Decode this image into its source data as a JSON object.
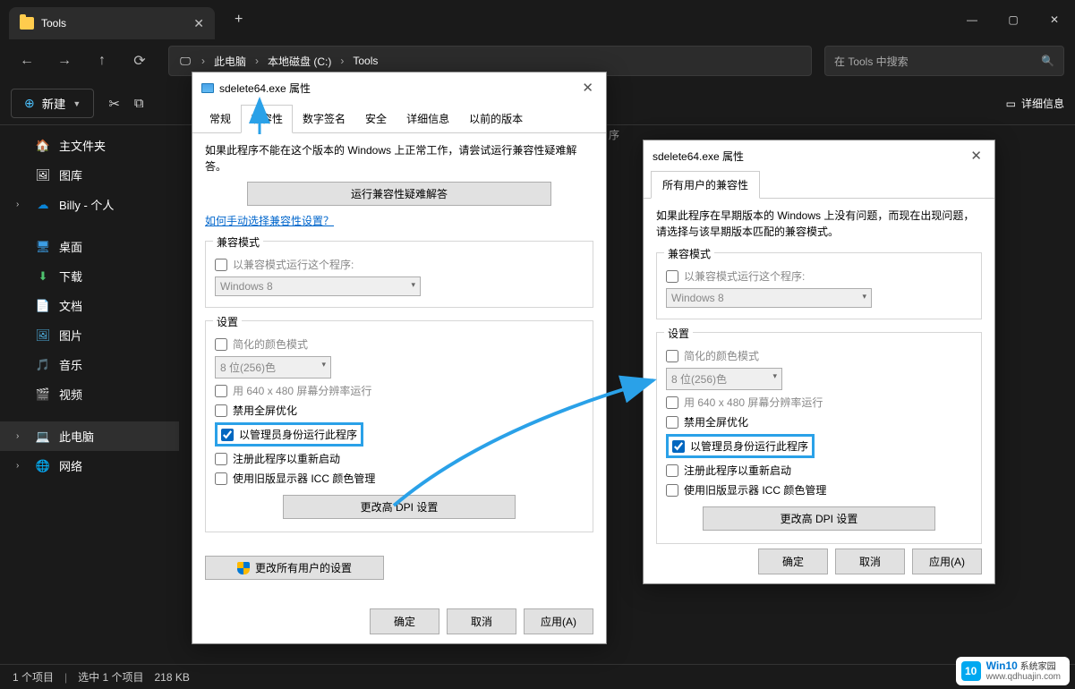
{
  "titlebar": {
    "tab_title": "Tools"
  },
  "toolbar": {
    "breadcrumb": {
      "pc": "此电脑",
      "disk": "本地磁盘 (C:)",
      "folder": "Tools"
    },
    "search_placeholder": "在 Tools 中搜索"
  },
  "actions": {
    "new_label": "新建",
    "details_label": "详细信息"
  },
  "sidebar": {
    "home": "主文件夹",
    "gallery": "图库",
    "onedrive": "Billy - 个人",
    "desktop": "桌面",
    "downloads": "下载",
    "documents": "文档",
    "pictures": "图片",
    "music": "音乐",
    "videos": "视频",
    "this_pc": "此电脑",
    "network": "网络"
  },
  "bg_header": "序",
  "statusbar": {
    "items": "1 个项目",
    "selected": "选中 1 个项目",
    "size": "218 KB"
  },
  "dialog1": {
    "title": "sdelete64.exe 属性",
    "tabs": {
      "general": "常规",
      "compat": "兼容性",
      "sig": "数字签名",
      "security": "安全",
      "details": "详细信息",
      "prev": "以前的版本"
    },
    "desc": "如果此程序不能在这个版本的 Windows 上正常工作，请尝试运行兼容性疑难解答。",
    "troubleshoot": "运行兼容性疑难解答",
    "manual_link": "如何手动选择兼容性设置？",
    "compat_group": "兼容模式",
    "compat_chk": "以兼容模式运行这个程序:",
    "compat_os": "Windows 8",
    "settings_group": "设置",
    "reduced_color": "简化的颜色模式",
    "color_mode": "8 位(256)色",
    "res640": "用 640 x 480 屏幕分辨率运行",
    "fullscreen": "禁用全屏优化",
    "admin": "以管理员身份运行此程序",
    "register": "注册此程序以重新启动",
    "icc": "使用旧版显示器 ICC 颜色管理",
    "dpi_btn": "更改高 DPI 设置",
    "all_users_btn": "更改所有用户的设置",
    "ok": "确定",
    "cancel": "取消",
    "apply": "应用(A)"
  },
  "dialog2": {
    "title": "sdelete64.exe 属性",
    "tab": "所有用户的兼容性",
    "desc": "如果此程序在早期版本的 Windows 上没有问题，而现在出现问题，请选择与该早期版本匹配的兼容模式。",
    "compat_group": "兼容模式",
    "compat_chk": "以兼容模式运行这个程序:",
    "compat_os": "Windows 8",
    "settings_group": "设置",
    "reduced_color": "简化的颜色模式",
    "color_mode": "8 位(256)色",
    "res640": "用 640 x 480 屏幕分辨率运行",
    "fullscreen": "禁用全屏优化",
    "admin": "以管理员身份运行此程序",
    "register": "注册此程序以重新启动",
    "icc": "使用旧版显示器 ICC 颜色管理",
    "dpi_btn": "更改高 DPI 设置",
    "ok": "确定",
    "cancel": "取消",
    "apply": "应用(A)"
  },
  "watermark": {
    "brand": "Win10",
    "sub1": "系统家园",
    "sub2": "www.qdhuajin.com"
  }
}
